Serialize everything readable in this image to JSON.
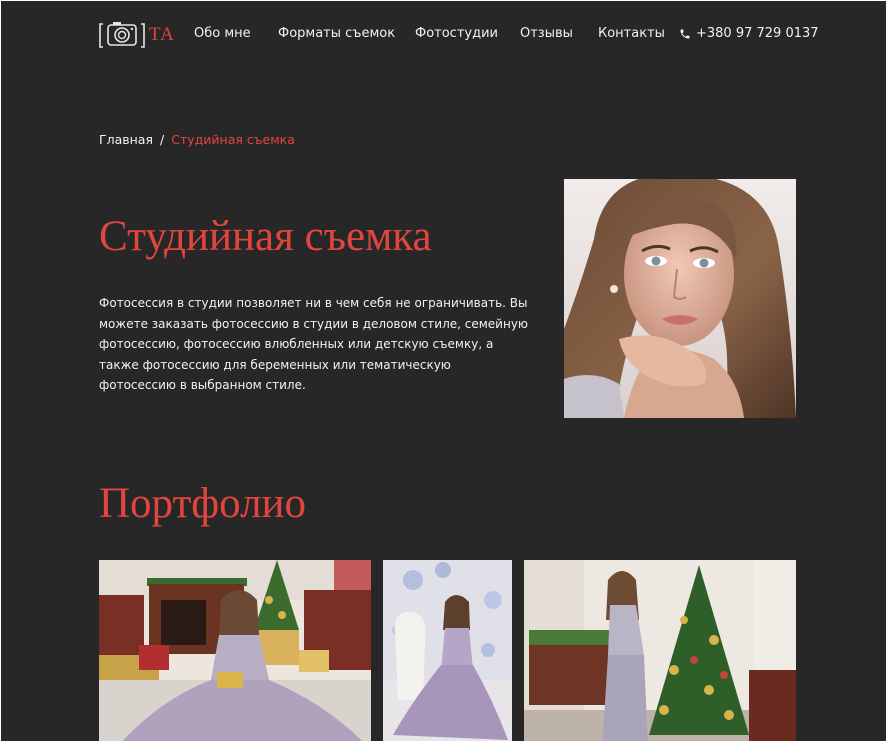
{
  "header": {
    "logo_text": "ТА",
    "nav": [
      {
        "label": "Обо мне"
      },
      {
        "label": "Форматы съемок"
      },
      {
        "label": "Фотостудии"
      },
      {
        "label": "Отзывы"
      },
      {
        "label": "Контакты"
      }
    ],
    "phone": "+380 97 729 0137",
    "phone_icon": "phone-icon",
    "logo_icon": "camera-icon"
  },
  "breadcrumb": {
    "home": "Главная",
    "separator": "/",
    "current": "Студийная съемка"
  },
  "hero": {
    "title": "Студийная съемка",
    "text": "Фотосессия в студии позволяет ни в чем себя не ограничивать. Вы можете заказать фотосессию в студии в деловом стиле, семейную фотосессию, фотосессию влюбленных или детскую съемку, а также фотосессию для беременных или тематическую фотосессию в выбранном стиле."
  },
  "portfolio": {
    "title": "Портфолио"
  },
  "colors": {
    "background": "#282728",
    "accent": "#e1463e",
    "text": "#f2f2f2"
  }
}
